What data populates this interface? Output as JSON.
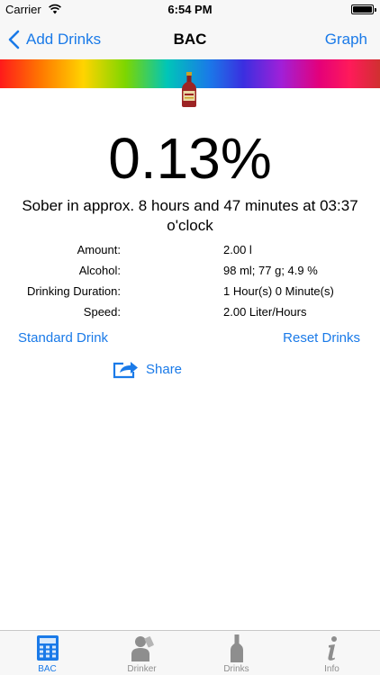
{
  "status_bar": {
    "carrier": "Carrier",
    "time": "6:54 PM"
  },
  "nav": {
    "back_label": "Add Drinks",
    "title": "BAC",
    "graph_label": "Graph"
  },
  "bac": {
    "value": "0.13%",
    "sober_line1": "Sober in approx. 8 hours and 47 minutes at 03:37",
    "sober_line2": "o'clock"
  },
  "details": [
    {
      "label": "Amount:",
      "value": "2.00 l"
    },
    {
      "label": "Alcohol:",
      "value": "98 ml; 77 g; 4.9 %"
    },
    {
      "label": "Drinking Duration:",
      "value": "1 Hour(s) 0 Minute(s)"
    },
    {
      "label": "Speed:",
      "value": "2.00 Liter/Hours"
    }
  ],
  "actions": {
    "standard_drink": "Standard Drink",
    "reset_drinks": "Reset Drinks",
    "share": "Share"
  },
  "tabs": [
    {
      "label": "BAC",
      "icon": "calculator-icon",
      "active": true
    },
    {
      "label": "Drinker",
      "icon": "drinker-icon",
      "active": false
    },
    {
      "label": "Drinks",
      "icon": "bottle-icon",
      "active": false
    },
    {
      "label": "Info",
      "icon": "info-icon",
      "active": false
    }
  ],
  "colors": {
    "accent": "#1a7ae8",
    "inactive_tab": "#8e8e8e",
    "bar_background": "#f7f7f7"
  }
}
